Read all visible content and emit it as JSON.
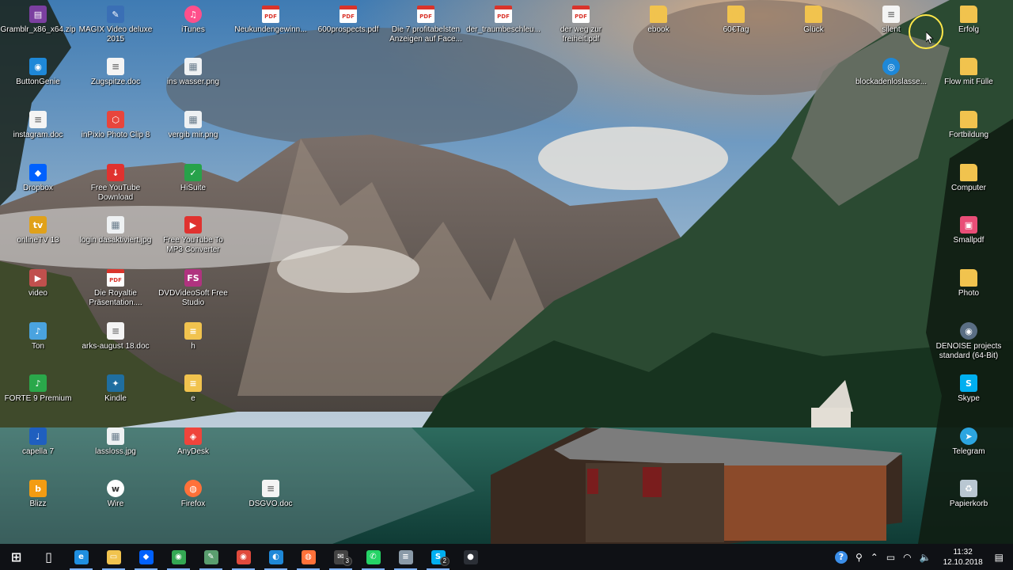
{
  "desktop": {
    "icons": [
      {
        "label": "Gramblr_x86_x64.zip",
        "icon": "winrar-archive-icon",
        "color": "#7b3fa0",
        "kind": "plain",
        "glyph": "▤"
      },
      {
        "label": "MAGIX Video deluxe 2015",
        "icon": "magix-video-icon",
        "color": "#3a6fb5",
        "kind": "plain",
        "glyph": "✎"
      },
      {
        "label": "iTunes",
        "icon": "itunes-icon",
        "color": "#ff4f8b",
        "kind": "round",
        "glyph": "♫"
      },
      {
        "label": "Neukundengewinn...",
        "icon": "pdf-file-icon",
        "color": "#d9342b",
        "kind": "pdf",
        "glyph": "PDF"
      },
      {
        "label": "600prospects.pdf",
        "icon": "pdf-file-icon",
        "color": "#d9342b",
        "kind": "pdf",
        "glyph": "PDF"
      },
      {
        "label": "Die 7 profitabelsten Anzeigen auf Face...",
        "icon": "pdf-file-icon",
        "color": "#d9342b",
        "kind": "pdf",
        "glyph": "PDF"
      },
      {
        "label": "der_traumbeschleu...",
        "icon": "pdf-file-icon",
        "color": "#d9342b",
        "kind": "pdf",
        "glyph": "PDF"
      },
      {
        "label": "der weg zur freiheit.pdf",
        "icon": "pdf-file-icon",
        "color": "#d9342b",
        "kind": "pdf",
        "glyph": "PDF"
      },
      {
        "label": "ebook",
        "icon": "folder-icon",
        "color": "#f1c34e",
        "kind": "folder",
        "glyph": "▭"
      },
      {
        "label": "60€Tag",
        "icon": "folder-icon",
        "color": "#f1c34e",
        "kind": "folder",
        "glyph": "▭"
      },
      {
        "label": "Glück",
        "icon": "folder-icon",
        "color": "#f1c34e",
        "kind": "folder",
        "glyph": "▭"
      },
      {
        "label": "silent",
        "icon": "document-icon",
        "color": "#dcdcdc",
        "kind": "doc",
        "glyph": "≡"
      },
      {
        "label": "Erfolg",
        "icon": "folder-icon",
        "color": "#f1c34e",
        "kind": "folder",
        "glyph": "▭"
      },
      {
        "label": "ButtonGenie",
        "icon": "buttongenie-icon",
        "color": "#1e88d8",
        "kind": "plain",
        "glyph": "◉"
      },
      {
        "label": "Zugspitze.doc",
        "icon": "document-icon",
        "color": "#dcdcdc",
        "kind": "doc",
        "glyph": "≡"
      },
      {
        "label": "ins wasser.png",
        "icon": "image-file-icon",
        "color": "#dcdcdc",
        "kind": "img",
        "glyph": "▦"
      },
      {
        "label": "blockadenloslasse...",
        "icon": "media-file-icon",
        "color": "#1e88d8",
        "kind": "round",
        "glyph": "◎"
      },
      {
        "label": "Flow mit Fülle",
        "icon": "folder-icon",
        "color": "#f1c34e",
        "kind": "folder",
        "glyph": "▭"
      },
      {
        "label": "instagram.doc",
        "icon": "document-icon",
        "color": "#dcdcdc",
        "kind": "doc",
        "glyph": "≡"
      },
      {
        "label": "inPixio Photo Clip 8",
        "icon": "inpixio-icon",
        "color": "#e8453c",
        "kind": "plain",
        "glyph": "⬡"
      },
      {
        "label": "vergib mir.png",
        "icon": "image-file-icon",
        "color": "#dcdcdc",
        "kind": "img",
        "glyph": "▦"
      },
      {
        "label": "Fortbildung",
        "icon": "folder-icon",
        "color": "#f1c34e",
        "kind": "folder",
        "glyph": "▭"
      },
      {
        "label": "Dropbox",
        "icon": "dropbox-icon",
        "color": "#0061fe",
        "kind": "plain",
        "glyph": "◆"
      },
      {
        "label": "Free YouTube Download",
        "icon": "download-icon",
        "color": "#e0322f",
        "kind": "plain",
        "glyph": "↓"
      },
      {
        "label": "HiSuite",
        "icon": "hisuite-icon",
        "color": "#27a24a",
        "kind": "plain",
        "glyph": "✓"
      },
      {
        "label": "Computer",
        "icon": "folder-icon",
        "color": "#f1c34e",
        "kind": "folder",
        "glyph": "▭"
      },
      {
        "label": "onlineTV 13",
        "icon": "onlinetv-icon",
        "color": "#e0a11a",
        "kind": "plain",
        "glyph": "tv"
      },
      {
        "label": "login dasaktiviert.jpg",
        "icon": "image-file-icon",
        "color": "#dcdcdc",
        "kind": "img",
        "glyph": "▦"
      },
      {
        "label": "Free YouTube To MP3 Converter",
        "icon": "youtube-mp3-icon",
        "color": "#e0322f",
        "kind": "plain",
        "glyph": "▶"
      },
      {
        "label": "Smallpdf",
        "icon": "smallpdf-icon",
        "color": "#e94e77",
        "kind": "plain",
        "glyph": "▣"
      },
      {
        "label": "video",
        "icon": "video-folder-icon",
        "color": "#c0504d",
        "kind": "plain",
        "glyph": "▶"
      },
      {
        "label": "Die Royaltie Präsentation....",
        "icon": "pdf-file-icon",
        "color": "#d9342b",
        "kind": "pdf",
        "glyph": "PDF"
      },
      {
        "label": "DVDVideoSoft Free Studio",
        "icon": "dvdvideosoft-icon",
        "color": "#b0337f",
        "kind": "plain",
        "glyph": "FS"
      },
      {
        "label": "Photo",
        "icon": "folder-icon",
        "color": "#f1c34e",
        "kind": "folder",
        "glyph": "▭"
      },
      {
        "label": "Ton",
        "icon": "audio-folder-icon",
        "color": "#4aa3df",
        "kind": "plain",
        "glyph": "♪"
      },
      {
        "label": "arks-august 18.doc",
        "icon": "document-icon",
        "color": "#dcdcdc",
        "kind": "doc",
        "glyph": "≡"
      },
      {
        "label": "h",
        "icon": "text-file-icon",
        "color": "#f1c34e",
        "kind": "plain",
        "glyph": "≡"
      },
      {
        "label": "DENOISE projects standard (64-Bit)",
        "icon": "denoise-icon",
        "color": "#5a6e84",
        "kind": "round",
        "glyph": "◉"
      },
      {
        "label": "FORTE 9 Premium",
        "icon": "forte-icon",
        "color": "#2aa84a",
        "kind": "plain",
        "glyph": "♪"
      },
      {
        "label": "Kindle",
        "icon": "kindle-icon",
        "color": "#1f6ea0",
        "kind": "plain",
        "glyph": "✦"
      },
      {
        "label": "e",
        "icon": "text-file-icon",
        "color": "#f1c34e",
        "kind": "plain",
        "glyph": "≡"
      },
      {
        "label": "Skype",
        "icon": "skype-icon",
        "color": "#00aff0",
        "kind": "plain",
        "glyph": "S"
      },
      {
        "label": "capella 7",
        "icon": "capella-icon",
        "color": "#1f5fbf",
        "kind": "plain",
        "glyph": "♩"
      },
      {
        "label": "lassloss.jpg",
        "icon": "image-file-icon",
        "color": "#dcdcdc",
        "kind": "img",
        "glyph": "▦"
      },
      {
        "label": "AnyDesk",
        "icon": "anydesk-icon",
        "color": "#ef443b",
        "kind": "plain",
        "glyph": "◈"
      },
      {
        "label": "Telegram",
        "icon": "telegram-icon",
        "color": "#2ca5e0",
        "kind": "round",
        "glyph": "➤"
      },
      {
        "label": "Blizz",
        "icon": "blizz-icon",
        "color": "#f39c12",
        "kind": "plain",
        "glyph": "b"
      },
      {
        "label": "Wire",
        "icon": "wire-icon",
        "color": "#ffffff",
        "kind": "round",
        "glyph": "w"
      },
      {
        "label": "Firefox",
        "icon": "firefox-icon",
        "color": "#ff7139",
        "kind": "round",
        "glyph": "◍"
      },
      {
        "label": "DSGVO.doc",
        "icon": "document-icon",
        "color": "#dcdcdc",
        "kind": "doc",
        "glyph": "≡"
      },
      {
        "label": "Papierkorb",
        "icon": "recycle-bin-icon",
        "color": "#b9c7d2",
        "kind": "plain",
        "glyph": "♻"
      }
    ]
  },
  "taskbar": {
    "apps": [
      {
        "name": "start-button",
        "icon": "windows-logo-icon",
        "color": "#ffffff",
        "glyph": "⊞",
        "badge": ""
      },
      {
        "name": "task-view-button",
        "icon": "task-view-icon",
        "color": "#ffffff",
        "glyph": "▯",
        "badge": ""
      },
      {
        "name": "taskbar-edge",
        "icon": "edge-icon",
        "color": "#1f8fe0",
        "glyph": "e",
        "badge": ""
      },
      {
        "name": "taskbar-file-explorer",
        "icon": "file-explorer-icon",
        "color": "#f1c34e",
        "glyph": "▭",
        "badge": ""
      },
      {
        "name": "taskbar-dropbox",
        "icon": "dropbox-icon",
        "color": "#0061fe",
        "glyph": "◆",
        "badge": ""
      },
      {
        "name": "taskbar-chrome",
        "icon": "chrome-icon",
        "color": "#34a853",
        "glyph": "◉",
        "badge": ""
      },
      {
        "name": "taskbar-app-green",
        "icon": "app-icon",
        "color": "#5a9e6f",
        "glyph": "✎",
        "badge": ""
      },
      {
        "name": "taskbar-chrome-alt",
        "icon": "chrome-icon",
        "color": "#e04a3c",
        "glyph": "◉",
        "badge": ""
      },
      {
        "name": "taskbar-app-blue",
        "icon": "app-icon",
        "color": "#1e88d8",
        "glyph": "◐",
        "badge": ""
      },
      {
        "name": "taskbar-firefox",
        "icon": "firefox-icon",
        "color": "#ff7139",
        "glyph": "◍",
        "badge": ""
      },
      {
        "name": "taskbar-mail",
        "icon": "mail-icon",
        "color": "#444444",
        "glyph": "✉",
        "badge": "3"
      },
      {
        "name": "taskbar-whatsapp",
        "icon": "whatsapp-icon",
        "color": "#25d366",
        "glyph": "✆",
        "badge": ""
      },
      {
        "name": "taskbar-notepad",
        "icon": "notepad-icon",
        "color": "#8a9aa8",
        "glyph": "≡",
        "badge": ""
      },
      {
        "name": "taskbar-skype",
        "icon": "skype-icon",
        "color": "#00aff0",
        "glyph": "S",
        "badge": "2"
      },
      {
        "name": "taskbar-recorder",
        "icon": "recorder-icon",
        "color": "#2b2f36",
        "glyph": "●",
        "badge": ""
      }
    ],
    "tray": {
      "help_glyph": "?",
      "people_glyph": "⚲",
      "chevron_glyph": "⌃",
      "battery_glyph": "▭",
      "network_glyph": "◠",
      "volume_glyph": "🔈",
      "notification_glyph": "▤",
      "time": "11:32",
      "date": "12.10.2018"
    }
  }
}
